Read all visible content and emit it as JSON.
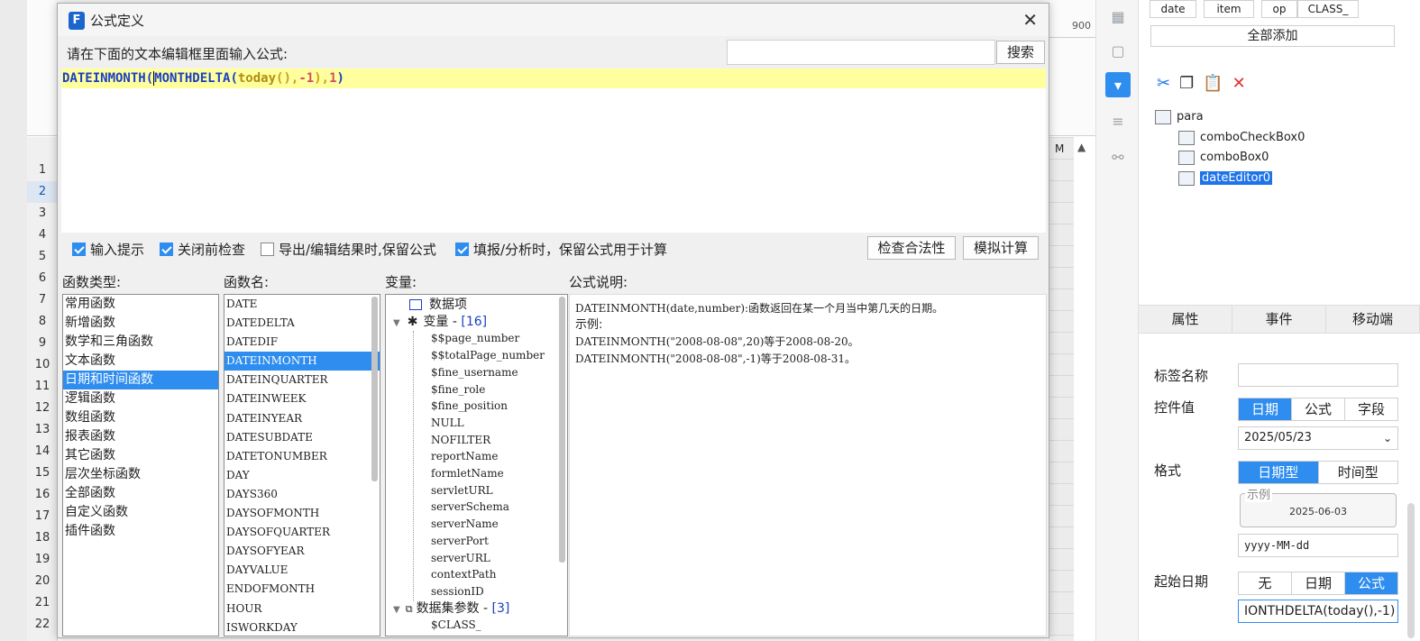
{
  "background": {
    "ruler_value": "900",
    "row_numbers": [
      "1",
      "2",
      "3",
      "4",
      "5",
      "6",
      "7",
      "8",
      "9",
      "10",
      "11",
      "12",
      "13",
      "14",
      "15",
      "16",
      "17",
      "18",
      "19",
      "20",
      "21",
      "22"
    ],
    "selected_row": "2",
    "col_letter": "M"
  },
  "right_panel": {
    "tags": [
      "date",
      "item",
      "op",
      "CLASS_"
    ],
    "add_all": "全部添加",
    "tree": {
      "root": "para",
      "children": [
        "comboCheckBox0",
        "comboBox0",
        "dateEditor0"
      ],
      "selected": "dateEditor0"
    },
    "tabs": [
      "属性",
      "事件",
      "移动端"
    ],
    "props": {
      "label_name": "标签名称",
      "control_value": "控件值",
      "control_value_options": [
        "日期",
        "公式",
        "字段"
      ],
      "date_value": "2025/05/23",
      "format": "格式",
      "format_options": [
        "日期型",
        "时间型"
      ],
      "example_caption": "示例",
      "example_value": "2025-06-03",
      "format_pattern": "yyyy-MM-dd",
      "start_date": "起始日期",
      "start_date_options": [
        "无",
        "日期",
        "公式"
      ],
      "start_formula": "IONTHDELTA(today(),-1)"
    }
  },
  "dialog": {
    "title": "公式定义",
    "prompt": "请在下面的文本编辑框里面输入公式:",
    "search_button": "搜索",
    "formula": {
      "fn": "DATEINMONTH(",
      "inner_fn": "MONTHDELTA(",
      "call": "today",
      "parens": "()",
      "comma1": ",",
      "arg1": "-1",
      "close1": ")",
      "comma2": ",",
      "arg2": "1",
      "close2": ")"
    },
    "options": [
      {
        "label": "输入提示",
        "checked": true
      },
      {
        "label": "关闭前检查",
        "checked": true
      },
      {
        "label": "导出/编辑结果时,保留公式",
        "checked": false
      },
      {
        "label": "填报/分析时，保留公式用于计算",
        "checked": true
      }
    ],
    "check_button": "检查合法性",
    "simulate_button": "模拟计算",
    "headers": {
      "fn_type": "函数类型:",
      "fn_name": "函数名:",
      "variables": "变量:",
      "description": "公式说明:"
    },
    "fn_types": [
      "常用函数",
      "新增函数",
      "数学和三角函数",
      "文本函数",
      "日期和时间函数",
      "逻辑函数",
      "数组函数",
      "报表函数",
      "其它函数",
      "层次坐标函数",
      "全部函数",
      "自定义函数",
      "插件函数"
    ],
    "selected_fn_type": "日期和时间函数",
    "fn_names": [
      "DATE",
      "DATEDELTA",
      "DATEDIF",
      "DATEINMONTH",
      "DATEINQUARTER",
      "DATEINWEEK",
      "DATEINYEAR",
      "DATESUBDATE",
      "DATETONUMBER",
      "DAY",
      "DAYS360",
      "DAYSOFMONTH",
      "DAYSOFQUARTER",
      "DAYSOFYEAR",
      "DAYVALUE",
      "ENDOFMONTH",
      "HOUR",
      "ISWORKDAY"
    ],
    "selected_fn_name": "DATEINMONTH",
    "variables": {
      "data_item": "数据项",
      "var_group": "变量 - ",
      "var_count": "[16]",
      "vars": [
        "$$page_number",
        "$$totalPage_number",
        "$fine_username",
        "$fine_role",
        "$fine_position",
        "NULL",
        "NOFILTER",
        "reportName",
        "formletName",
        "servletURL",
        "serverSchema",
        "serverName",
        "serverPort",
        "serverURL",
        "contextPath",
        "sessionID"
      ],
      "ds_group": "数据集参数 - ",
      "ds_count": "[3]",
      "ds_vars": [
        "$CLASS_"
      ]
    },
    "description_lines": [
      "DATEINMONTH(date,number):函数返回在某一个月当中第几天的日期。",
      "示例:",
      "DATEINMONTH(\"2008-08-08\",20)等于2008-08-20。",
      "DATEINMONTH(\"2008-08-08\",-1)等于2008-08-31。"
    ]
  }
}
